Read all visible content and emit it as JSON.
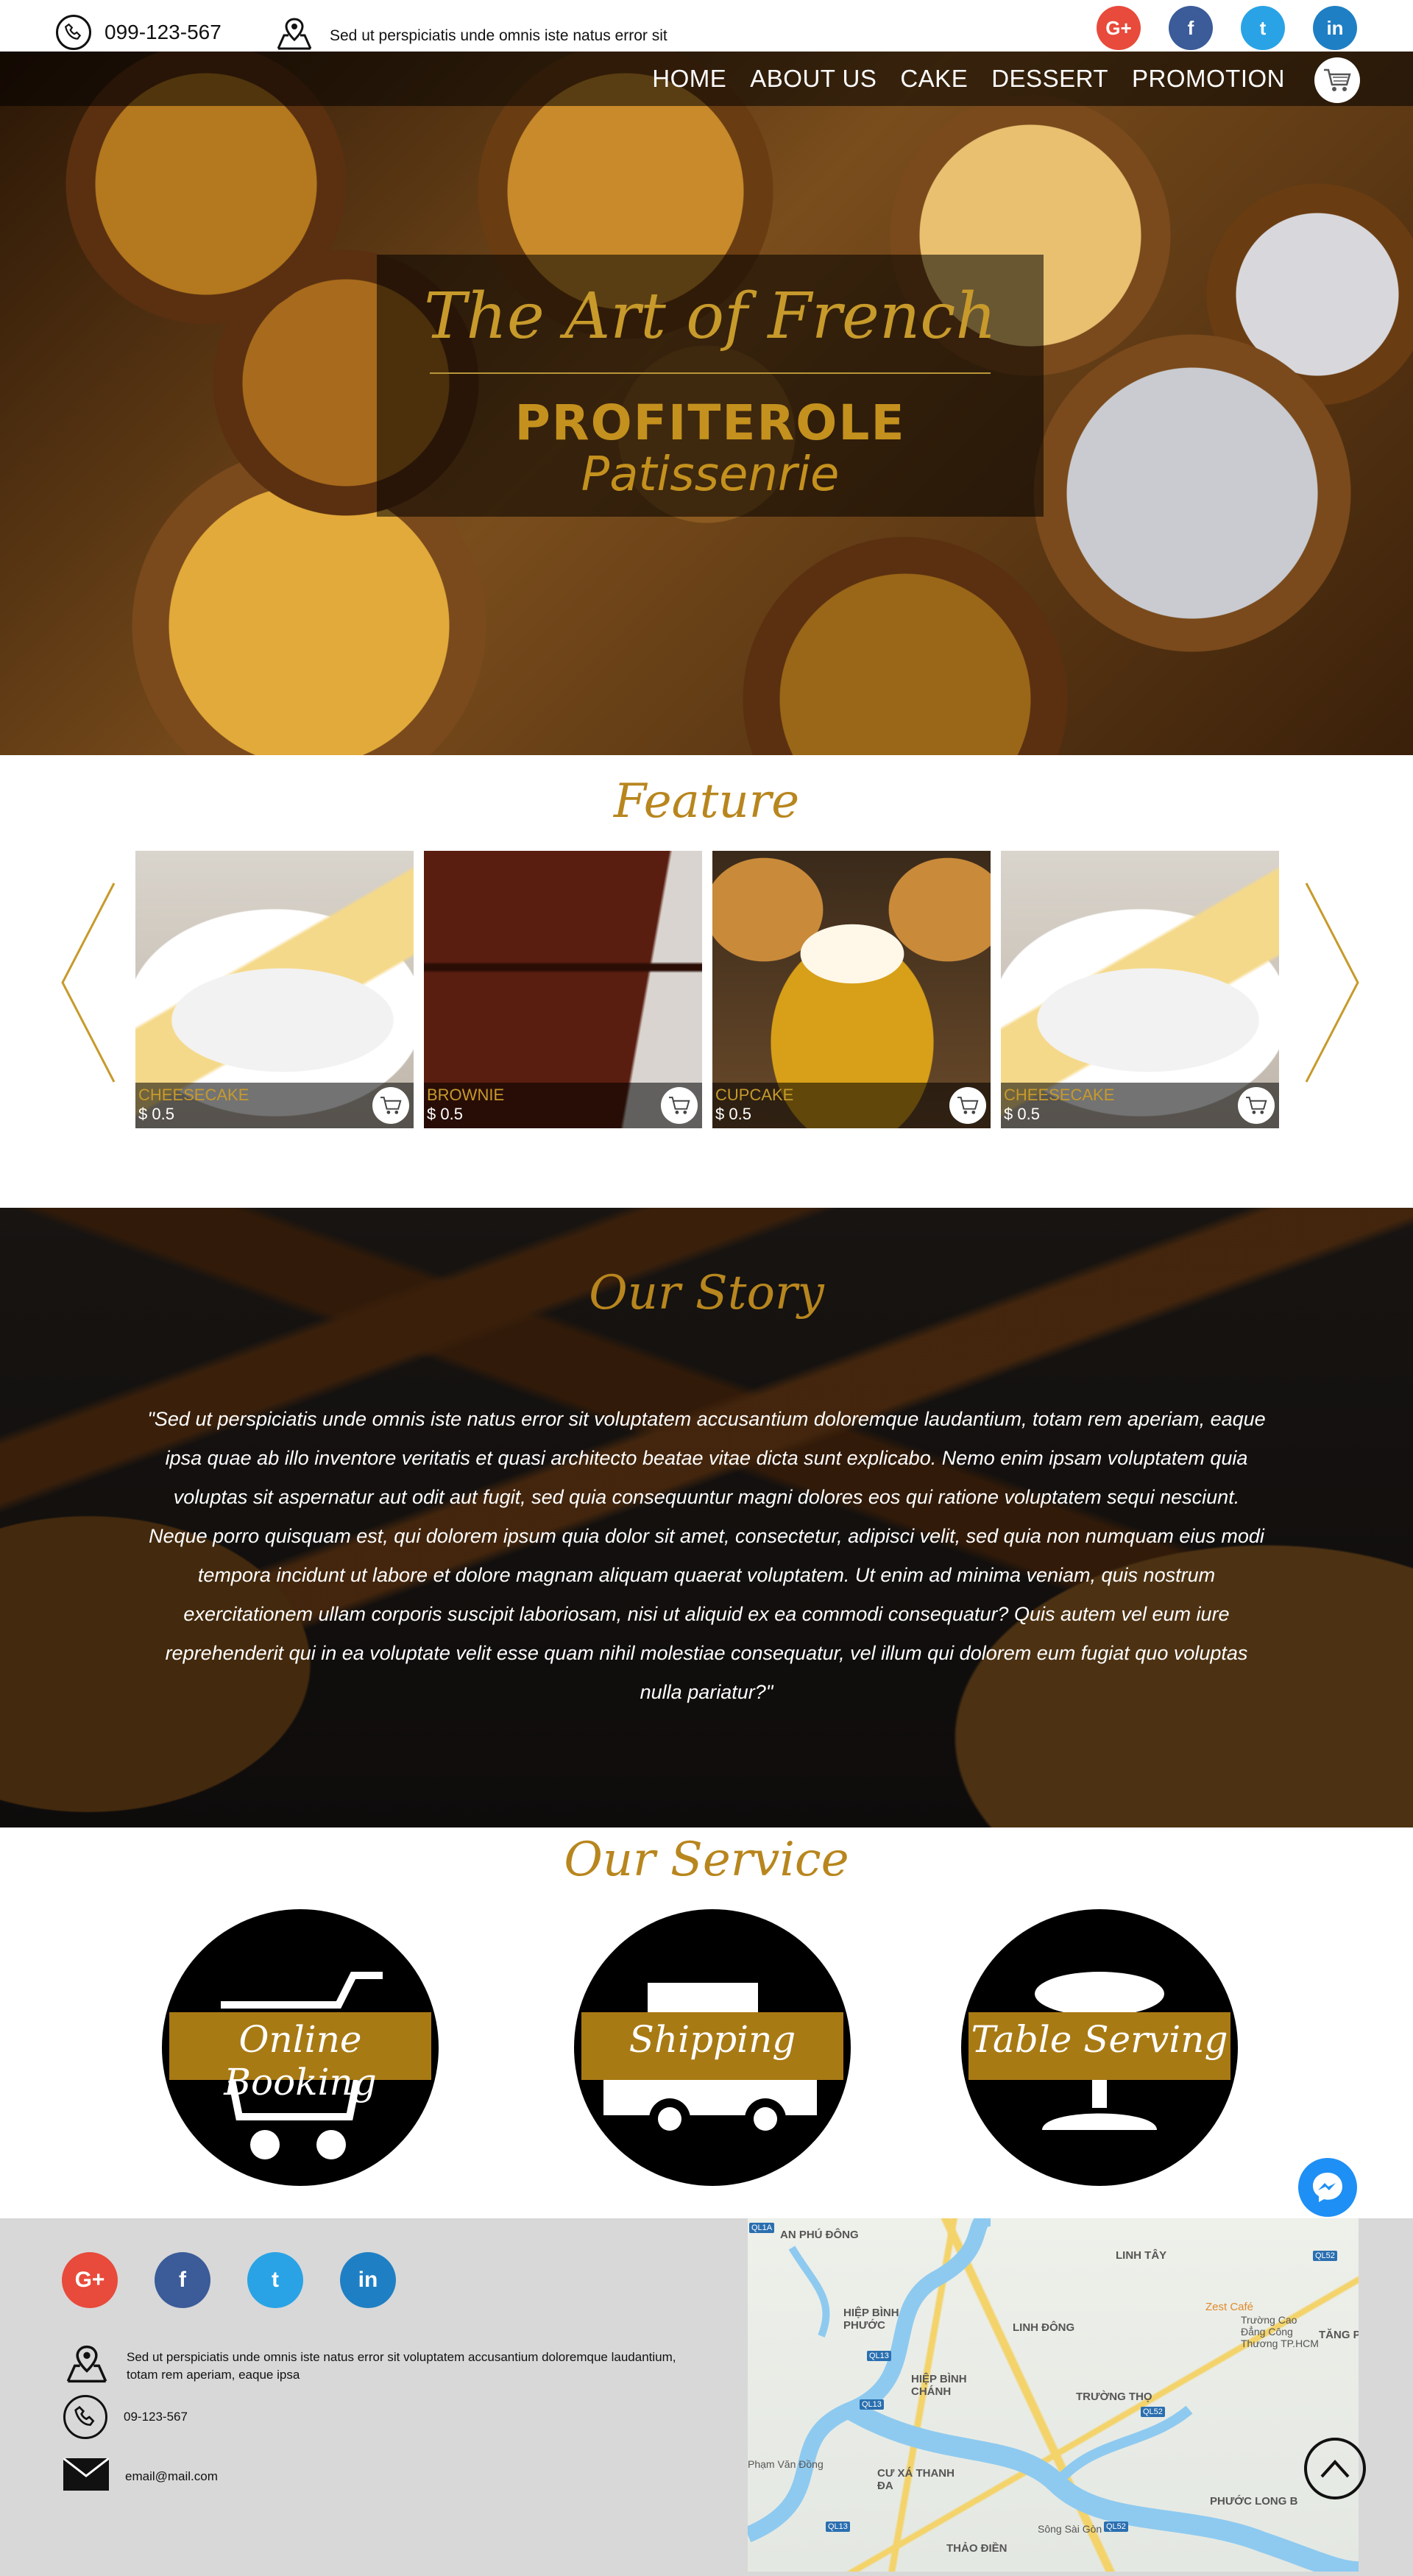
{
  "topbar": {
    "phone": "099-123-567",
    "address": "Sed ut perspiciatis unde omnis iste natus error sit",
    "social": [
      {
        "icon": "google-plus-icon",
        "label": "G+",
        "color": "#e84a3b"
      },
      {
        "icon": "facebook-icon",
        "label": "f",
        "color": "#3b5b99"
      },
      {
        "icon": "twitter-icon",
        "label": "t",
        "color": "#29a3e6"
      },
      {
        "icon": "linkedin-icon",
        "label": "in",
        "color": "#1f7fc4"
      }
    ]
  },
  "nav": {
    "items": [
      "HOME",
      "ABOUT US",
      "CAKE",
      "DESSERT",
      "PROMOTION"
    ],
    "cart_icon": "shopping-cart-icon"
  },
  "hero": {
    "script_title": "The Art of French",
    "title": "PROFITEROLE",
    "subtitle": "Patissenrie"
  },
  "feature": {
    "title": "Feature",
    "prev_icon": "chevron-left-icon",
    "next_icon": "chevron-right-icon",
    "cards": [
      {
        "name": "CHEESECAKE",
        "price": "$ 0.5"
      },
      {
        "name": "BROWNIE",
        "price": "$ 0.5"
      },
      {
        "name": "CUPCAKE",
        "price": "$ 0.5"
      },
      {
        "name": "CHEESECAKE",
        "price": "$ 0.5"
      }
    ]
  },
  "story": {
    "title": "Our Story",
    "text": "\"Sed ut perspiciatis unde omnis iste natus error sit voluptatem accusantium doloremque laudantium, totam rem aperiam, eaque ipsa quae ab illo inventore veritatis et quasi architecto beatae vitae dicta sunt explicabo. Nemo enim ipsam voluptatem quia voluptas sit aspernatur aut odit aut fugit, sed quia consequuntur magni dolores eos qui ratione voluptatem sequi nesciunt. Neque porro quisquam est, qui dolorem ipsum quia dolor sit amet, consectetur, adipisci velit, sed quia non numquam eius modi tempora incidunt ut labore et dolore magnam aliquam quaerat voluptatem. Ut enim ad minima veniam, quis nostrum exercitationem ullam corporis suscipit laboriosam, nisi ut aliquid ex ea commodi consequatur? Quis autem vel eum iure reprehenderit qui in ea voluptate velit esse quam nihil molestiae consequatur, vel illum qui dolorem eum fugiat quo voluptas nulla pariatur?\""
  },
  "service": {
    "title": "Our Service",
    "items": [
      {
        "label": "Online Booking",
        "icon": "shopping-cart-icon"
      },
      {
        "label": "Shipping",
        "icon": "delivery-truck-icon"
      },
      {
        "label": "Table Serving",
        "icon": "serving-cloche-icon"
      }
    ]
  },
  "footer": {
    "address": "Sed ut perspiciatis unde omnis iste natus error sit voluptatem accusantium doloremque laudantium, totam rem aperiam, eaque ipsa",
    "phone": "09-123-567",
    "email": "email@mail.com"
  },
  "map": {
    "labels": [
      "AN PHÚ ĐÔNG",
      "LINH TÂY",
      "HIỆP BÌNH PHƯỚC",
      "LINH ĐÔNG",
      "HIỆP BÌNH CHÁNH",
      "TRƯỜNG THỌ",
      "CƯ XÁ THANH ĐA",
      "PHƯỚC LONG B",
      "THẢO ĐIỀN",
      "TĂNG PH"
    ],
    "poi": "Zest Café",
    "poi_sub": "Trường Cao Đẳng Công Thương TP.HCM",
    "road_labels": [
      "Phạm Văn Đồng",
      "Sông Sài Gòn"
    ],
    "badges": [
      "QL1A",
      "QL52",
      "QL13",
      "QL13",
      "QL52",
      "QL13",
      "QL52"
    ]
  },
  "widgets": {
    "messenger_icon": "messenger-icon",
    "back_to_top_icon": "arrow-up-icon"
  },
  "colors": {
    "accent": "#b8861e",
    "service_band": "#a87a14",
    "footer_bg": "#d8d8d8"
  }
}
